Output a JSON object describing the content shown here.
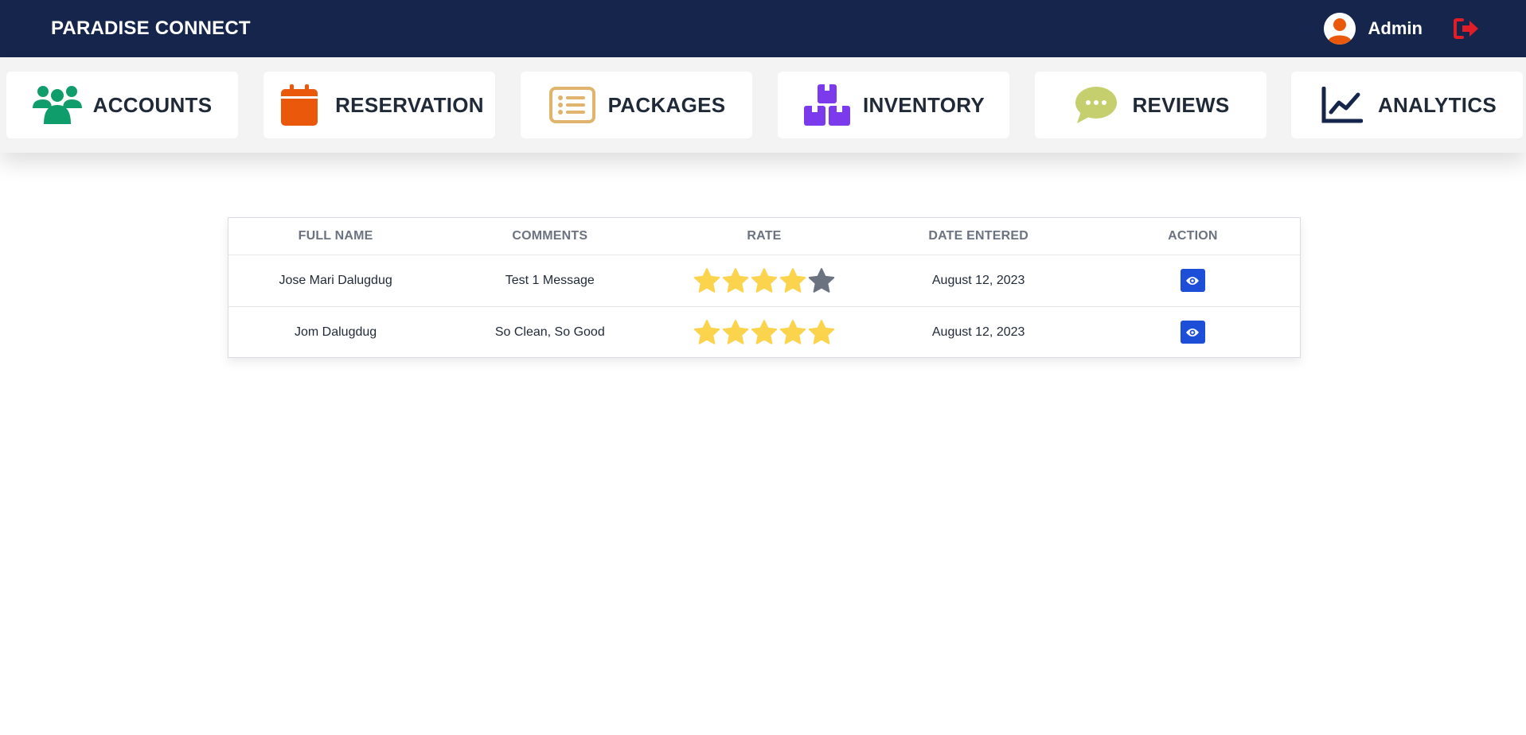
{
  "header": {
    "brand": "PARADISE CONNECT",
    "user_name": "Admin",
    "user_icon": "user-avatar-icon",
    "logout_icon": "logout-icon",
    "bg_color": "#16254b",
    "logout_color": "#e11d2a"
  },
  "nav": {
    "items": [
      {
        "label": "ACCOUNTS",
        "icon": "users-icon",
        "color": "#0f9d6b"
      },
      {
        "label": "RESERVATION",
        "icon": "calendar-icon",
        "color": "#ea580c"
      },
      {
        "label": "PACKAGES",
        "icon": "list-icon",
        "color": "#e0b46c"
      },
      {
        "label": "INVENTORY",
        "icon": "boxes-icon",
        "color": "#7c3aed"
      },
      {
        "label": "REVIEWS",
        "icon": "comment-icon",
        "color": "#c6cf6d"
      },
      {
        "label": "ANALYTICS",
        "icon": "chart-line-icon",
        "color": "#16254b"
      }
    ]
  },
  "reviews_table": {
    "columns": [
      "FULL NAME",
      "COMMENTS",
      "RATE",
      "DATE ENTERED",
      "ACTION"
    ],
    "rows": [
      {
        "full_name": "Jose Mari Dalugdug",
        "comment": "Test 1 Message",
        "rating": 4,
        "max_rating": 5,
        "date": "August 12, 2023",
        "action_icon": "eye-icon"
      },
      {
        "full_name": "Jom Dalugdug",
        "comment": "So Clean, So Good",
        "rating": 5,
        "max_rating": 5,
        "date": "August 12, 2023",
        "action_icon": "eye-icon"
      }
    ],
    "star_on_color": "#fcd34d",
    "star_off_color": "#6b7280",
    "action_color": "#1d4ed8"
  }
}
